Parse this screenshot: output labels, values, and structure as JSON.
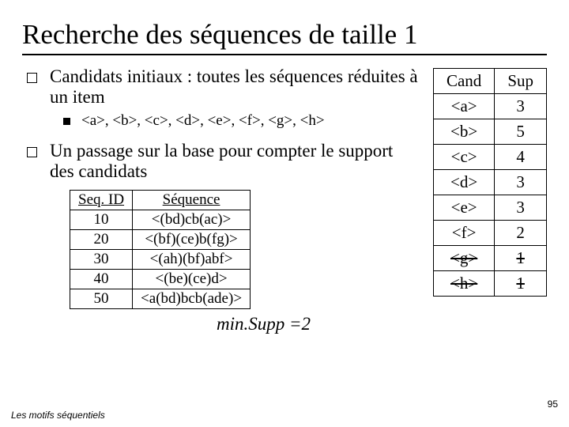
{
  "title": "Recherche des séquences de taille 1",
  "bullets": {
    "b1": "Candidats initiaux : toutes les séquences réduites à un item",
    "b1sub": "<a>, <b>, <c>, <d>, <e>, <f>, <g>, <h>",
    "b2": "Un passage sur la base pour compter le support des candidats"
  },
  "seq_table": {
    "headers": [
      "Seq. ID",
      "Séquence"
    ],
    "rows": [
      [
        "10",
        "<(bd)cb(ac)>"
      ],
      [
        "20",
        "<(bf)(ce)b(fg)>"
      ],
      [
        "30",
        "<(ah)(bf)abf>"
      ],
      [
        "40",
        "<(be)(ce)d>"
      ],
      [
        "50",
        "<a(bd)bcb(ade)>"
      ]
    ]
  },
  "minsupp": "min.Supp =2",
  "cand_table": {
    "headers": [
      "Cand",
      "Sup"
    ],
    "rows": [
      {
        "cand": "<a>",
        "sup": "3",
        "strike": false
      },
      {
        "cand": "<b>",
        "sup": "5",
        "strike": false
      },
      {
        "cand": "<c>",
        "sup": "4",
        "strike": false
      },
      {
        "cand": "<d>",
        "sup": "3",
        "strike": false
      },
      {
        "cand": "<e>",
        "sup": "3",
        "strike": false
      },
      {
        "cand": "<f>",
        "sup": "2",
        "strike": false
      },
      {
        "cand": "<g>",
        "sup": "1",
        "strike": true
      },
      {
        "cand": "<h>",
        "sup": "1",
        "strike": true
      }
    ]
  },
  "pagenum": "95",
  "footer": "Les motifs séquentiels"
}
